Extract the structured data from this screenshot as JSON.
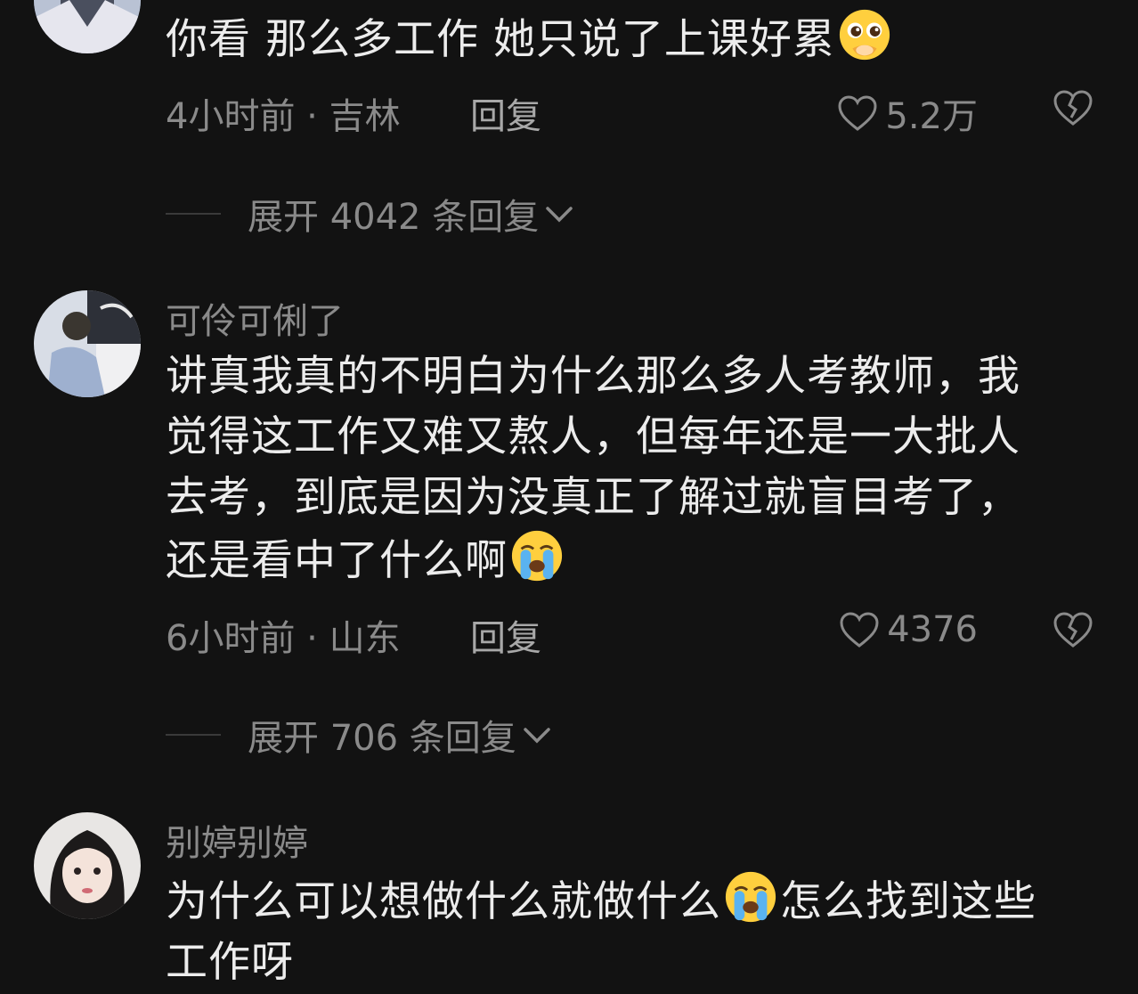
{
  "comments": [
    {
      "username": "",
      "lines": [
        "你看 那么多工作 她只说了上课好累"
      ],
      "time_location": "4小时前 · 吉林",
      "reply_label": "回复",
      "likes": "5.2万",
      "expand_text": "展开 4042 条回复"
    },
    {
      "username": "可伶可俐了",
      "lines": [
        "讲真我真的不明白为什么那么多人考教师，我",
        "觉得这工作又难又熬人，但每年还是一大批人",
        "去考，到底是因为没真正了解过就盲目考了，",
        "还是看中了什么啊"
      ],
      "time_location": "6小时前 · 山东",
      "reply_label": "回复",
      "likes": "4376",
      "expand_text": "展开 706 条回复"
    },
    {
      "username": "别婷别婷",
      "lines": [
        "为什么可以想做什么就做什么",
        "怎么找到这些",
        "工作呀"
      ]
    }
  ],
  "icons": {
    "like": "heart-outline-icon",
    "dislike": "broken-heart-icon",
    "expand": "chevron-down-icon",
    "emoji_pleading": "pleading-face-emoji",
    "emoji_crying": "loudly-crying-face-emoji"
  },
  "colors": {
    "background": "#121212",
    "text_primary": "#ececec",
    "text_secondary": "#8a8a8a"
  }
}
